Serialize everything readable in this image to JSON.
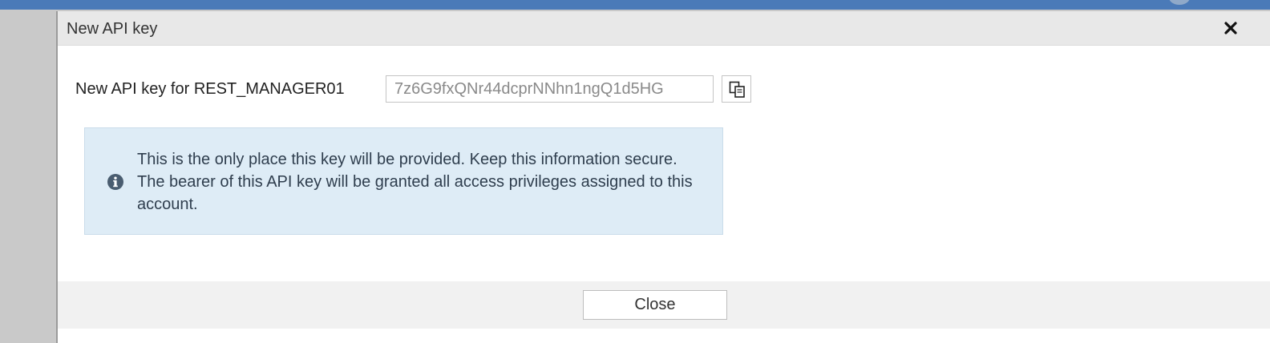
{
  "dialog": {
    "title": "New API key",
    "close_icon": "close-icon",
    "key_label": "New API key for REST_MANAGER01",
    "key_value": "7z6G9fxQNr44dcprNNhn1ngQ1d5HG",
    "copy_icon": "copy-icon",
    "info_icon": "info-icon",
    "info_text": "This is the only place this key will be provided. Keep this information secure. The bearer of this API key will be granted all access privileges assigned to this account.",
    "close_button_label": "Close"
  },
  "colors": {
    "top_bar": "#4a7ab8",
    "info_background": "#deecf6",
    "info_icon": "#4a5d70"
  }
}
